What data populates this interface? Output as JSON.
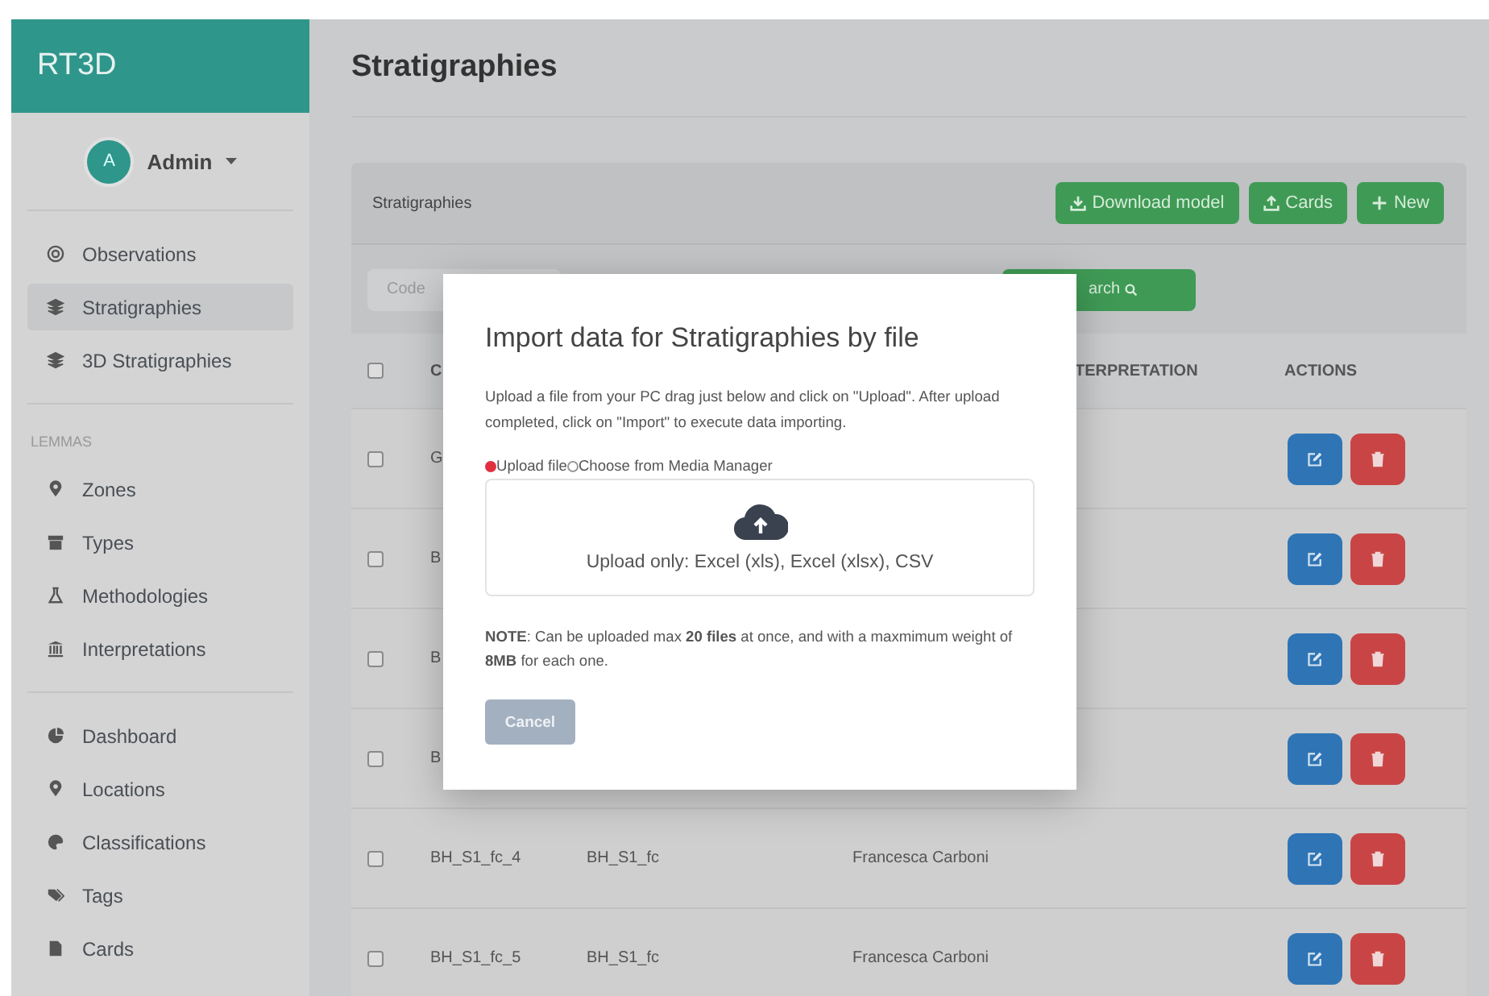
{
  "brand": "RT3D",
  "user": {
    "initial": "A",
    "name": "Admin"
  },
  "sidebar": {
    "groups": [
      {
        "items": [
          {
            "label": "Observations",
            "selected": false
          },
          {
            "label": "Stratigraphies",
            "selected": true
          },
          {
            "label": "3D Stratigraphies",
            "selected": false
          }
        ]
      },
      {
        "title": "LEMMAS",
        "items": [
          {
            "label": "Zones",
            "selected": false
          },
          {
            "label": "Types",
            "selected": false
          },
          {
            "label": "Methodologies",
            "selected": false
          },
          {
            "label": "Interpretations",
            "selected": false
          }
        ]
      },
      {
        "items": [
          {
            "label": "Dashboard",
            "selected": false
          },
          {
            "label": "Locations",
            "selected": false
          },
          {
            "label": "Classifications",
            "selected": false
          },
          {
            "label": "Tags",
            "selected": false
          },
          {
            "label": "Cards",
            "selected": false
          }
        ]
      }
    ]
  },
  "page_title": "Stratigraphies",
  "card": {
    "title": "Stratigraphies",
    "buttons": [
      {
        "label": "Download model",
        "kind": "download"
      },
      {
        "label": "Cards",
        "kind": "upload"
      },
      {
        "label": "New",
        "kind": "add"
      }
    ]
  },
  "filters": {
    "code_placeholder": "Code",
    "search_label": "arch"
  },
  "table": {
    "header_checked": false,
    "columns": [
      "C",
      "TERPRETATION",
      "ACTIONS"
    ],
    "rows": [
      {
        "checked": false,
        "code": "G"
      },
      {
        "checked": false,
        "code": "B"
      },
      {
        "checked": false,
        "code": "B"
      },
      {
        "checked": false,
        "code": "B"
      },
      {
        "checked": false,
        "code": "BH_S1_fc_4",
        "column_2": "BH_S1_fc",
        "column_3": "Francesca Carboni"
      },
      {
        "checked": false,
        "code": "BH_S1_fc_5",
        "column_2": "BH_S1_fc",
        "column_3": "Francesca Carboni"
      }
    ]
  },
  "modal": {
    "title": "Import data for Stratigraphies by file",
    "description": "Upload a file from your PC drag just below and click on \"Upload\". After upload completed, click on \"Import\" to execute data importing.",
    "sources": [
      {
        "label": "Upload file",
        "selected": true
      },
      {
        "label": "Choose from Media Manager",
        "selected": false
      }
    ],
    "dropzone_text": "Upload only: Excel (xls), Excel (xlsx), CSV",
    "note": "**NOTE**: Can be uploaded max **20 files** at once, and with a maxmimum weight of **8MB** for each one.",
    "cancel": "Cancel"
  }
}
